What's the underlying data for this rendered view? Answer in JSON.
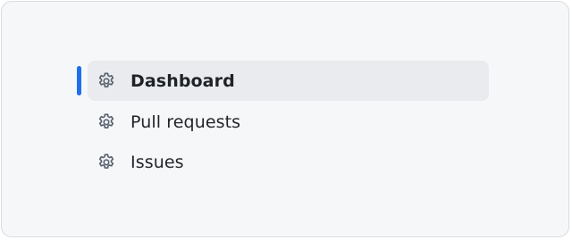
{
  "nav": {
    "items": [
      {
        "label": "Dashboard",
        "icon": "gear-icon",
        "active": true
      },
      {
        "label": "Pull requests",
        "icon": "gear-icon",
        "active": false
      },
      {
        "label": "Issues",
        "icon": "gear-icon",
        "active": false
      }
    ]
  },
  "colors": {
    "accent": "#1f6feb",
    "active_bg": "#e9ebee",
    "panel_bg": "#f6f7f9",
    "text": "#1f2328",
    "icon": "#59636e"
  }
}
